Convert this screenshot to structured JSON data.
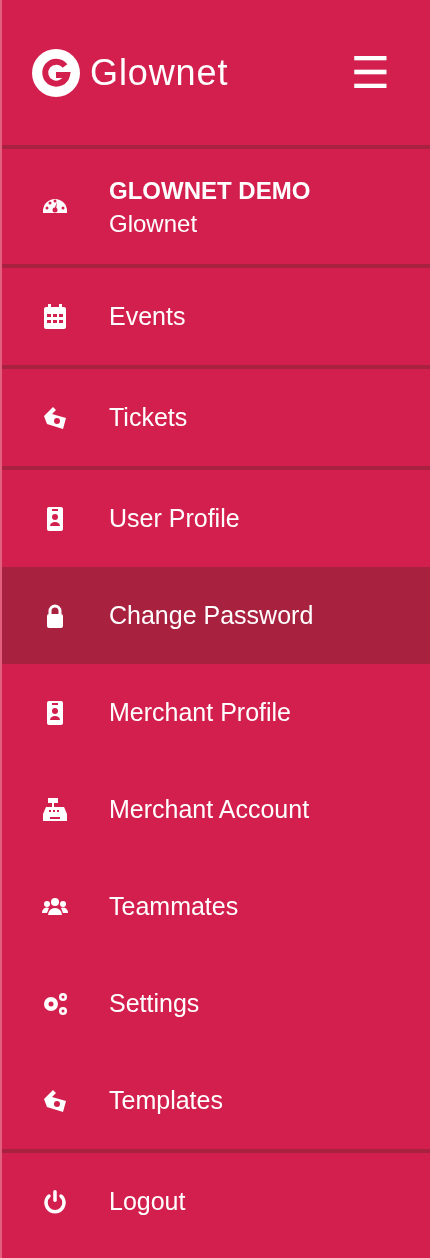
{
  "header": {
    "logo_text": "Glownet",
    "menu_glyph": "☰"
  },
  "sections": [
    {
      "items": [
        {
          "kind": "account",
          "title": "GLOWNET DEMO",
          "subtitle": "Glownet",
          "selected": false
        }
      ]
    },
    {
      "items": [
        {
          "kind": "link",
          "label": "Events",
          "selected": false
        }
      ]
    },
    {
      "items": [
        {
          "kind": "link",
          "label": "Tickets",
          "selected": false
        }
      ]
    },
    {
      "items": [
        {
          "kind": "link",
          "label": "User Profile",
          "selected": false
        },
        {
          "kind": "link",
          "label": "Change Password",
          "selected": true
        },
        {
          "kind": "link",
          "label": "Merchant Profile",
          "selected": false
        },
        {
          "kind": "link",
          "label": "Merchant Account",
          "selected": false
        },
        {
          "kind": "link",
          "label": "Teammates",
          "selected": false
        },
        {
          "kind": "link",
          "label": "Settings",
          "selected": false
        },
        {
          "kind": "link",
          "label": "Templates",
          "selected": false
        }
      ]
    },
    {
      "items": [
        {
          "kind": "link",
          "label": "Logout",
          "selected": false
        }
      ]
    }
  ]
}
